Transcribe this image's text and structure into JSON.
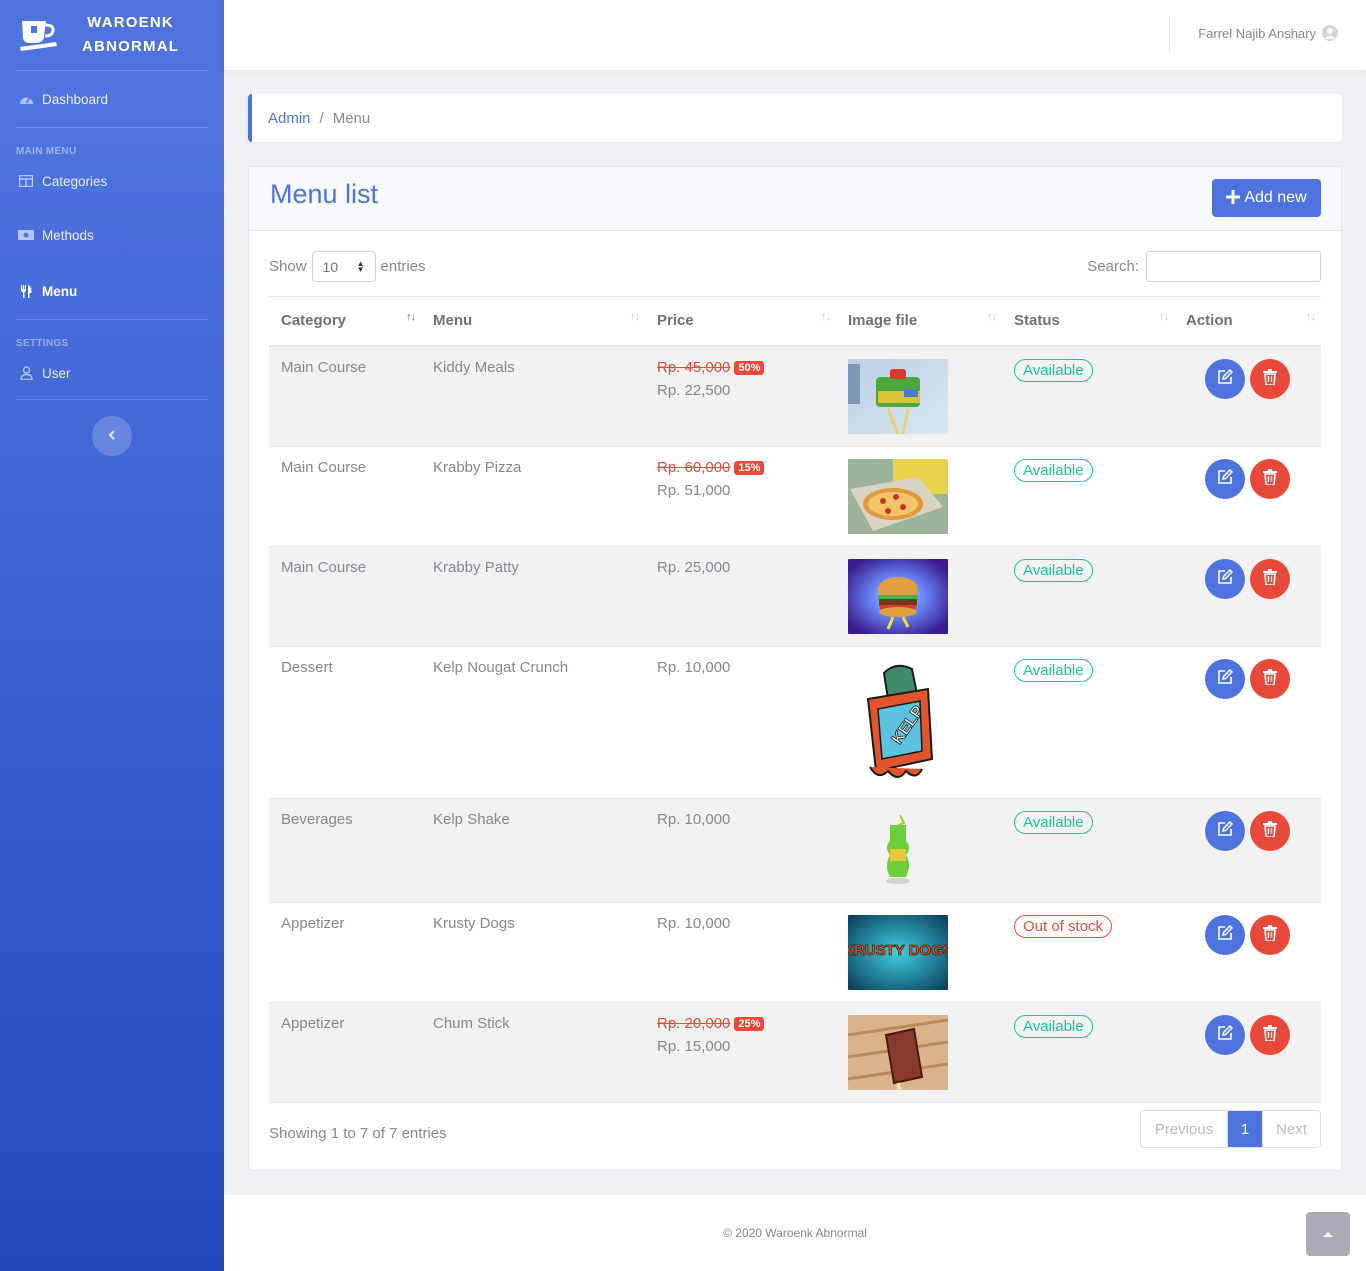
{
  "brand": {
    "line1": "WAROENK",
    "line2": "ABNORMAL",
    "icon": "coffee-cup-icon"
  },
  "sidebar": {
    "dashboard": "Dashboard",
    "main_heading": "MAIN MENU",
    "items": [
      {
        "label": "Categories",
        "icon": "table-icon"
      },
      {
        "label": "Methods",
        "icon": "money-bill-icon"
      },
      {
        "label": "Menu",
        "icon": "utensils-icon",
        "active": true
      }
    ],
    "settings_heading": "SETTINGS",
    "user": "User"
  },
  "topbar": {
    "user_name": "Farrel Najib Anshary"
  },
  "breadcrumb": {
    "root": "Admin",
    "sep": "/",
    "current": "Menu"
  },
  "card": {
    "title": "Menu list",
    "add_label": "Add new"
  },
  "table_controls": {
    "show": "Show",
    "entries_value": "10",
    "entries": "entries",
    "search": "Search:"
  },
  "table": {
    "columns": [
      "Category",
      "Menu",
      "Price",
      "Image file",
      "Status",
      "Action"
    ],
    "rows": [
      {
        "category": "Main Course",
        "menu": "Kiddy Meals",
        "old_price": "Rp. 45,000",
        "discount": "50%",
        "price": "Rp. 22,500",
        "status": "Available"
      },
      {
        "category": "Main Course",
        "menu": "Krabby Pizza",
        "old_price": "Rp. 60,000",
        "discount": "15%",
        "price": "Rp. 51,000",
        "status": "Available"
      },
      {
        "category": "Main Course",
        "menu": "Krabby Patty",
        "price": "Rp. 25,000",
        "status": "Available"
      },
      {
        "category": "Dessert",
        "menu": "Kelp Nougat Crunch",
        "price": "Rp. 10,000",
        "status": "Available",
        "image_text": "KELP"
      },
      {
        "category": "Beverages",
        "menu": "Kelp Shake",
        "price": "Rp. 10,000",
        "status": "Available"
      },
      {
        "category": "Appetizer",
        "menu": "Krusty Dogs",
        "price": "Rp. 10,000",
        "status": "Out of stock",
        "image_text": "KRUSTY DOGS"
      },
      {
        "category": "Appetizer",
        "menu": "Chum Stick",
        "old_price": "Rp. 20,000",
        "discount": "25%",
        "price": "Rp. 15,000",
        "status": "Available"
      }
    ]
  },
  "pagination": {
    "info": "Showing 1 to 7 of 7 entries",
    "prev": "Previous",
    "page": "1",
    "next": "Next"
  },
  "footer": {
    "text": "© 2020 Waroenk Abnormal"
  },
  "colors": {
    "primary": "#4e73df",
    "success": "#1cc88a",
    "danger": "#e74a3b"
  }
}
